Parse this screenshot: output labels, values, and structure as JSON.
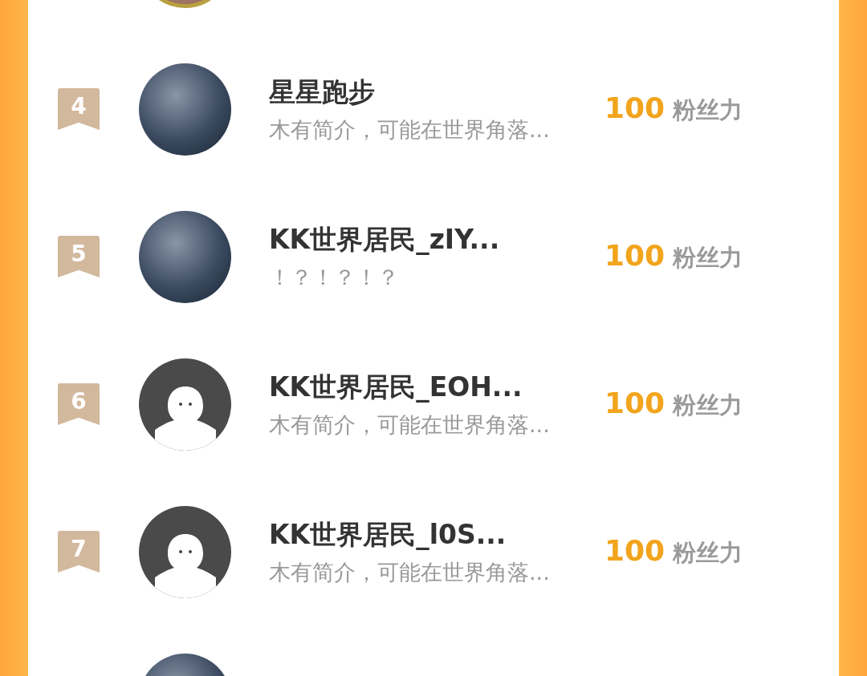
{
  "ranking": [
    {
      "kind": "cut_top",
      "avatar": {
        "kind": "photo"
      }
    },
    {
      "kind": "full",
      "rank": "4",
      "avatar": {
        "kind": "photo"
      },
      "name": "星星跑步",
      "bio": "木有简介，可能在世界角落...",
      "score": "100",
      "unit": "粉丝力"
    },
    {
      "kind": "full",
      "rank": "5",
      "avatar": {
        "kind": "photo"
      },
      "name": "KK世界居民_zIY...",
      "bio": "！？！？！？",
      "score": "100",
      "unit": "粉丝力"
    },
    {
      "kind": "full",
      "rank": "6",
      "avatar": {
        "kind": "default"
      },
      "name": "KK世界居民_EOH...",
      "bio": "木有简介，可能在世界角落...",
      "score": "100",
      "unit": "粉丝力"
    },
    {
      "kind": "full",
      "rank": "7",
      "avatar": {
        "kind": "default"
      },
      "name": "KK世界居民_l0S...",
      "bio": "木有简介，可能在世界角落...",
      "score": "100",
      "unit": "粉丝力"
    },
    {
      "kind": "cut_bottom",
      "avatar": {
        "kind": "photo"
      }
    }
  ]
}
